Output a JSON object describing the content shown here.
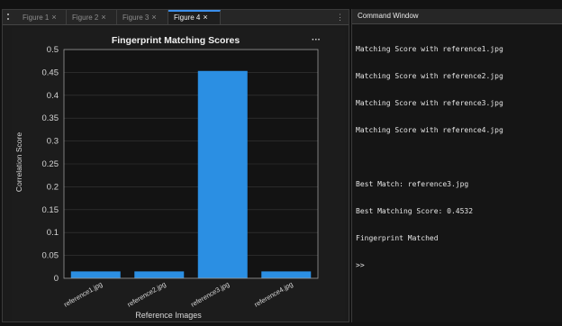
{
  "figure_window": {
    "tabs": [
      {
        "label": "Figure 1",
        "close": "×",
        "active": false
      },
      {
        "label": "Figure 2",
        "close": "×",
        "active": false
      },
      {
        "label": "Figure 3",
        "close": "×",
        "active": false
      },
      {
        "label": "Figure 4",
        "close": "×",
        "active": true
      }
    ],
    "menu_glyph": "⋮",
    "axes_toolbar_glyph": "···"
  },
  "command_window": {
    "title": "Command Window",
    "lines": [
      "Matching Score with reference1.jpg",
      "Matching Score with reference2.jpg",
      "Matching Score with reference3.jpg",
      "Matching Score with reference4.jpg",
      "",
      "Best Match: reference3.jpg",
      "Best Matching Score: 0.4532",
      "Fingerprint Matched",
      ">>"
    ]
  },
  "chart_data": {
    "type": "bar",
    "title": "Fingerprint Matching Scores",
    "xlabel": "Reference Images",
    "ylabel": "Correlation Score",
    "categories": [
      "reference1.jpg",
      "reference2.jpg",
      "reference3.jpg",
      "reference4.jpg"
    ],
    "values": [
      0.015,
      0.015,
      0.4532,
      0.015
    ],
    "ylim": [
      0,
      0.5
    ],
    "yticks": [
      0,
      0.05,
      0.1,
      0.15,
      0.2,
      0.25,
      0.3,
      0.35,
      0.4,
      0.45,
      0.5
    ],
    "ytick_labels": [
      "0",
      "0.05",
      "0.1",
      "0.15",
      "0.2",
      "0.25",
      "0.3",
      "0.35",
      "0.4",
      "0.45",
      "0.5"
    ],
    "grid": true,
    "bar_color": "#2b8fe3",
    "axes_background": "#131313",
    "grid_color": "#3a3a3a"
  }
}
